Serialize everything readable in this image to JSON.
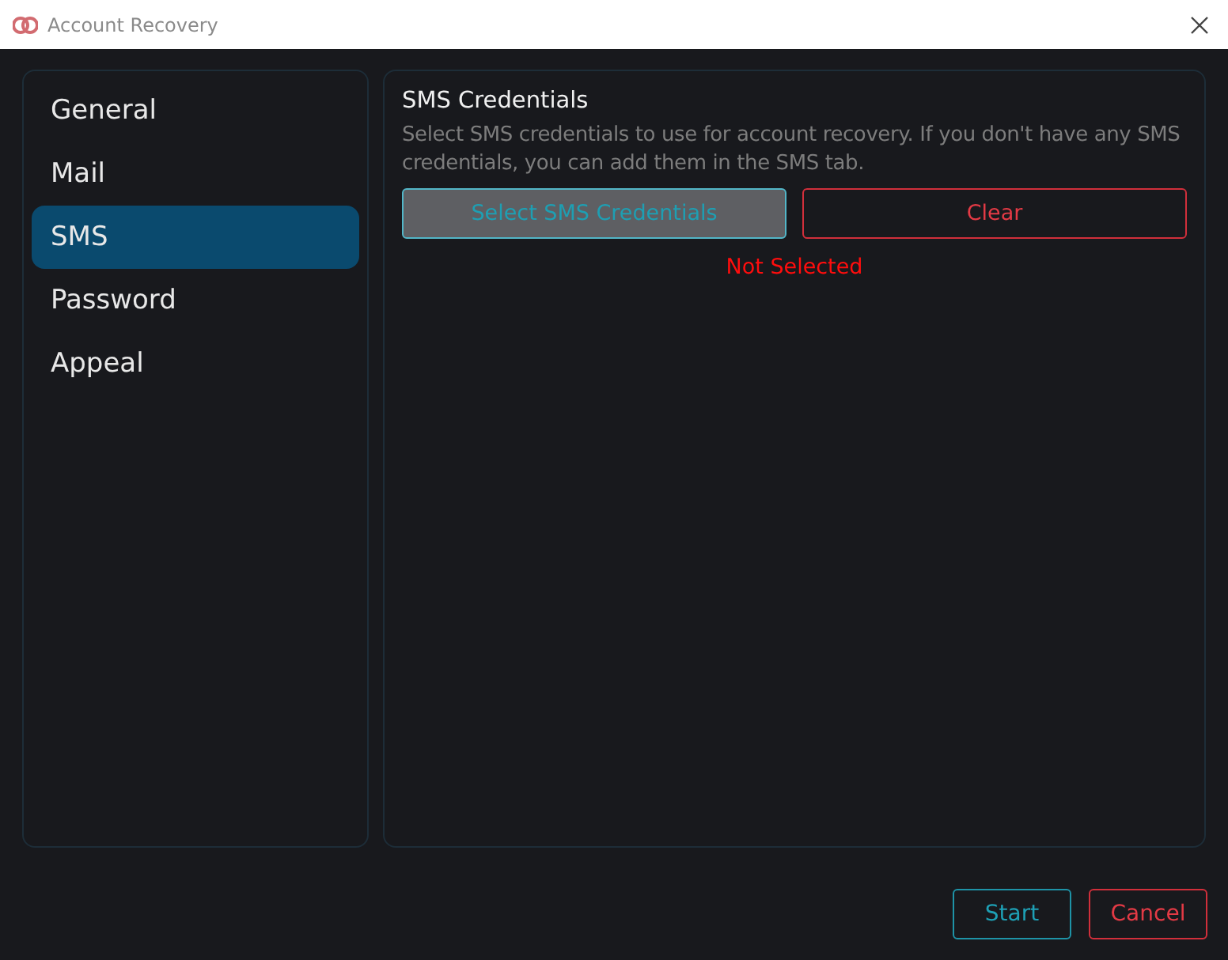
{
  "window": {
    "title": "Account Recovery"
  },
  "sidebar": {
    "items": [
      {
        "label": "General",
        "selected": false
      },
      {
        "label": "Mail",
        "selected": false
      },
      {
        "label": "SMS",
        "selected": true
      },
      {
        "label": "Password",
        "selected": false
      },
      {
        "label": "Appeal",
        "selected": false
      }
    ]
  },
  "section": {
    "title": "SMS Credentials",
    "description": "Select SMS credentials to use for account recovery. If you don't have any SMS credentials, you can add them in the SMS tab.",
    "select_button": "Select SMS Credentials",
    "clear_button": "Clear",
    "status": "Not Selected"
  },
  "buttons": {
    "start": "Start",
    "cancel": "Cancel"
  }
}
